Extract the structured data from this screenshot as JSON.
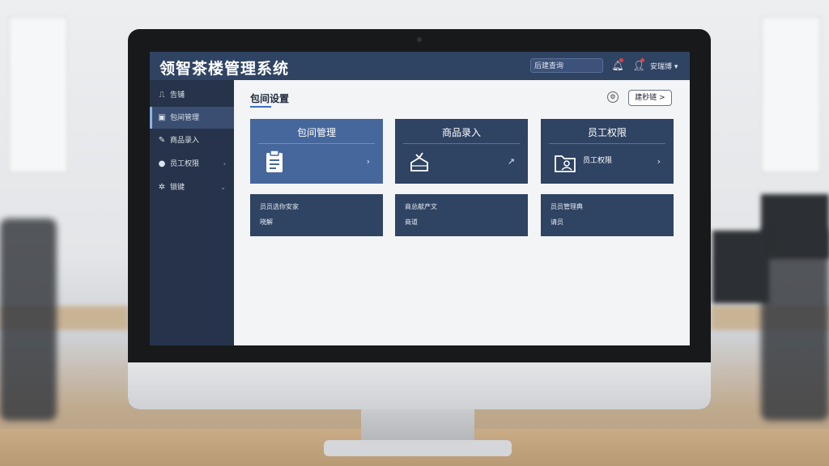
{
  "app": {
    "title": "领智茶楼管理系统",
    "search_placeholder": "后建查询",
    "user_name": "安瑞博"
  },
  "sidebar": {
    "items": [
      {
        "label": "告铺",
        "icon": "chart-icon"
      },
      {
        "label": "包间管理",
        "icon": "grid-icon",
        "active": true
      },
      {
        "label": "商品录入",
        "icon": "edit-icon"
      },
      {
        "label": "员工权限",
        "icon": "user-icon",
        "chevron": true
      },
      {
        "label": "锁键",
        "icon": "gear-icon",
        "chevron": true
      }
    ]
  },
  "main": {
    "page_title": "包间设置",
    "more_button": "建秒链 >",
    "cards": [
      {
        "title": "包间管理",
        "sub": "",
        "icon": "clipboard-icon",
        "arrow": "›"
      },
      {
        "title": "商品录入",
        "sub": "",
        "icon": "product-icon",
        "arrow": "↗"
      },
      {
        "title": "员工权限",
        "sub": "员工权限",
        "icon": "folder-user-icon",
        "arrow": "›"
      }
    ],
    "info_cards": [
      {
        "line1": "员员选你安家",
        "line2": "晓解"
      },
      {
        "line1": "商总献产文",
        "line2": "商道"
      },
      {
        "line1": "员员管理典",
        "line2": "请员"
      }
    ]
  },
  "colors": {
    "topbar": "#2f4363",
    "sidebar": "#26334a",
    "card": "#2f4363",
    "card_primary": "#46679c",
    "accent": "#3b6fc4"
  }
}
